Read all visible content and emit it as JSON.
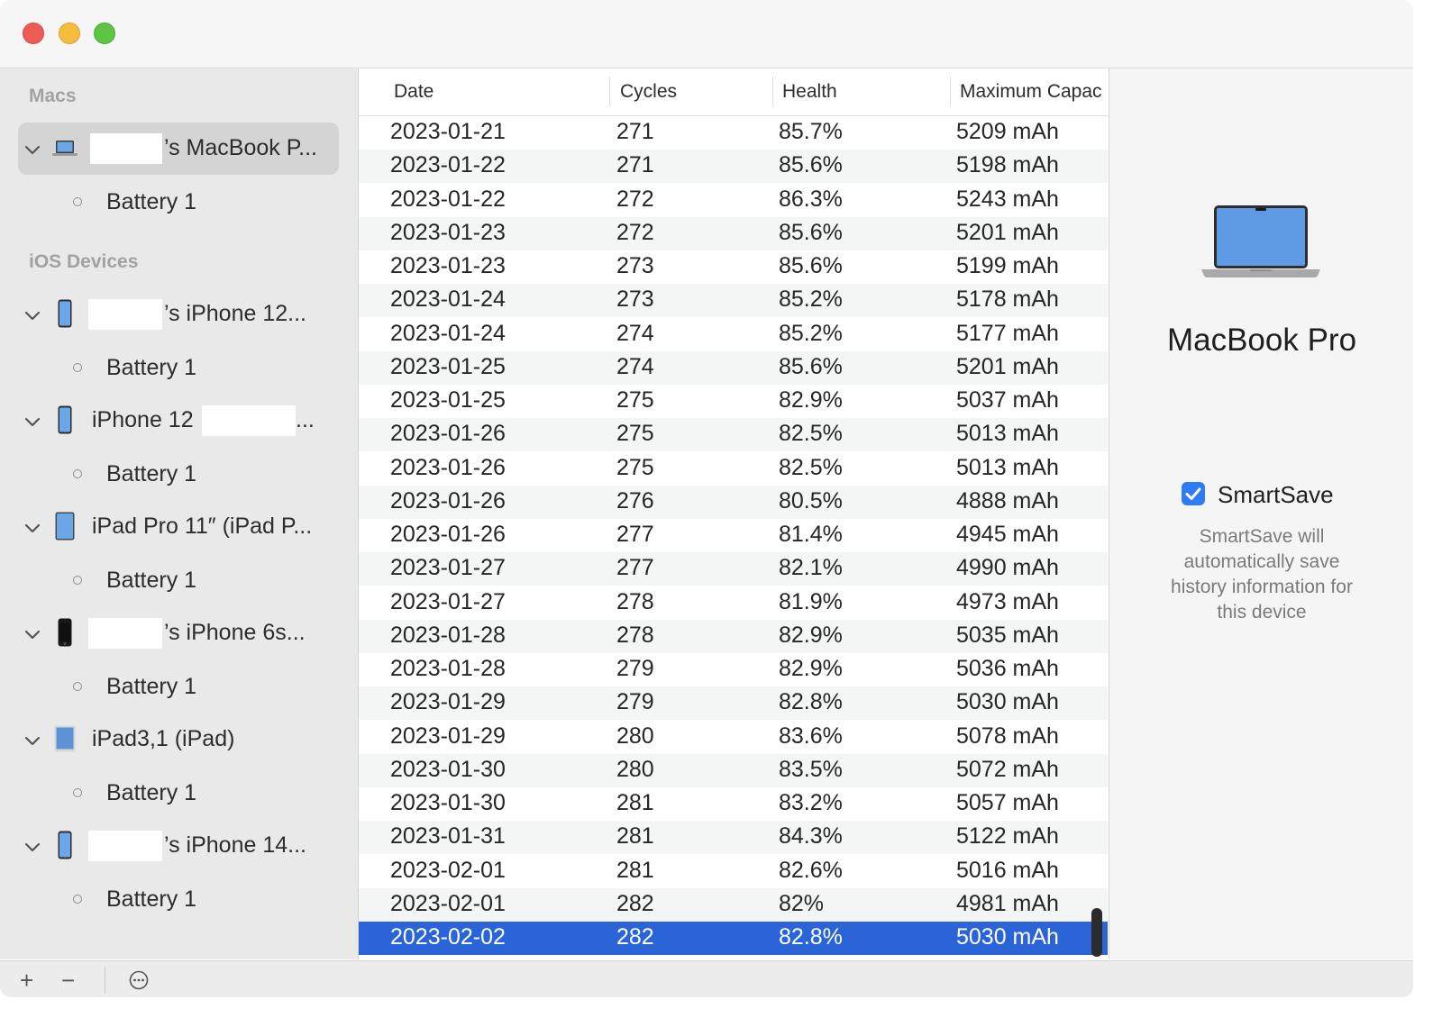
{
  "sidebar": {
    "sections": [
      {
        "header": "Macs"
      },
      {
        "header": "iOS Devices"
      }
    ],
    "devices": [
      {
        "label": "’s MacBook P...",
        "icon": "laptop-icon",
        "battery": "Battery 1"
      },
      {
        "label": "’s iPhone 12...",
        "icon": "iphone-icon",
        "battery": "Battery 1"
      },
      {
        "label": "iPhone 12",
        "suffix": "...",
        "icon": "iphone-icon",
        "battery": "Battery 1"
      },
      {
        "label": "iPad Pro 11″ (iPad P...",
        "icon": "ipad-icon",
        "battery": "Battery 1"
      },
      {
        "label": "’s iPhone 6s...",
        "icon": "iphone-black-icon",
        "battery": "Battery 1"
      },
      {
        "label": "iPad3,1 (iPad)",
        "icon": "ipad-icon",
        "battery": "Battery 1"
      },
      {
        "label": "’s iPhone 14...",
        "icon": "iphone-icon",
        "battery": "Battery 1"
      }
    ]
  },
  "table": {
    "columns": [
      "Date",
      "Cycles",
      "Health",
      "Maximum Capac"
    ],
    "rows": [
      [
        "2023-01-21",
        "271",
        "85.7%",
        "5209 mAh"
      ],
      [
        "2023-01-22",
        "271",
        "85.6%",
        "5198 mAh"
      ],
      [
        "2023-01-22",
        "272",
        "86.3%",
        "5243 mAh"
      ],
      [
        "2023-01-23",
        "272",
        "85.6%",
        "5201 mAh"
      ],
      [
        "2023-01-23",
        "273",
        "85.6%",
        "5199 mAh"
      ],
      [
        "2023-01-24",
        "273",
        "85.2%",
        "5178 mAh"
      ],
      [
        "2023-01-24",
        "274",
        "85.2%",
        "5177 mAh"
      ],
      [
        "2023-01-25",
        "274",
        "85.6%",
        "5201 mAh"
      ],
      [
        "2023-01-25",
        "275",
        "82.9%",
        "5037 mAh"
      ],
      [
        "2023-01-26",
        "275",
        "82.5%",
        "5013 mAh"
      ],
      [
        "2023-01-26",
        "275",
        "82.5%",
        "5013 mAh"
      ],
      [
        "2023-01-26",
        "276",
        "80.5%",
        "4888 mAh"
      ],
      [
        "2023-01-26",
        "277",
        "81.4%",
        "4945 mAh"
      ],
      [
        "2023-01-27",
        "277",
        "82.1%",
        "4990 mAh"
      ],
      [
        "2023-01-27",
        "278",
        "81.9%",
        "4973 mAh"
      ],
      [
        "2023-01-28",
        "278",
        "82.9%",
        "5035 mAh"
      ],
      [
        "2023-01-28",
        "279",
        "82.9%",
        "5036 mAh"
      ],
      [
        "2023-01-29",
        "279",
        "82.8%",
        "5030 mAh"
      ],
      [
        "2023-01-29",
        "280",
        "83.6%",
        "5078 mAh"
      ],
      [
        "2023-01-30",
        "280",
        "83.5%",
        "5072 mAh"
      ],
      [
        "2023-01-30",
        "281",
        "83.2%",
        "5057 mAh"
      ],
      [
        "2023-01-31",
        "281",
        "84.3%",
        "5122 mAh"
      ],
      [
        "2023-02-01",
        "281",
        "82.6%",
        "5016 mAh"
      ],
      [
        "2023-02-01",
        "282",
        "82%",
        "4981 mAh"
      ],
      [
        "2023-02-02",
        "282",
        "82.8%",
        "5030 mAh"
      ]
    ],
    "selected_row": 24
  },
  "panel": {
    "device_name": "MacBook Pro",
    "smartsave_label": "SmartSave",
    "smartsave_checked": true,
    "smartsave_desc": "SmartSave will automatically save history information for this device"
  },
  "colors": {
    "accent": "#2a64d6",
    "checkbox": "#2f7bf6"
  },
  "bottombar": {
    "add": "+",
    "remove": "−",
    "more_icon": "ellipsis-circle-icon"
  }
}
